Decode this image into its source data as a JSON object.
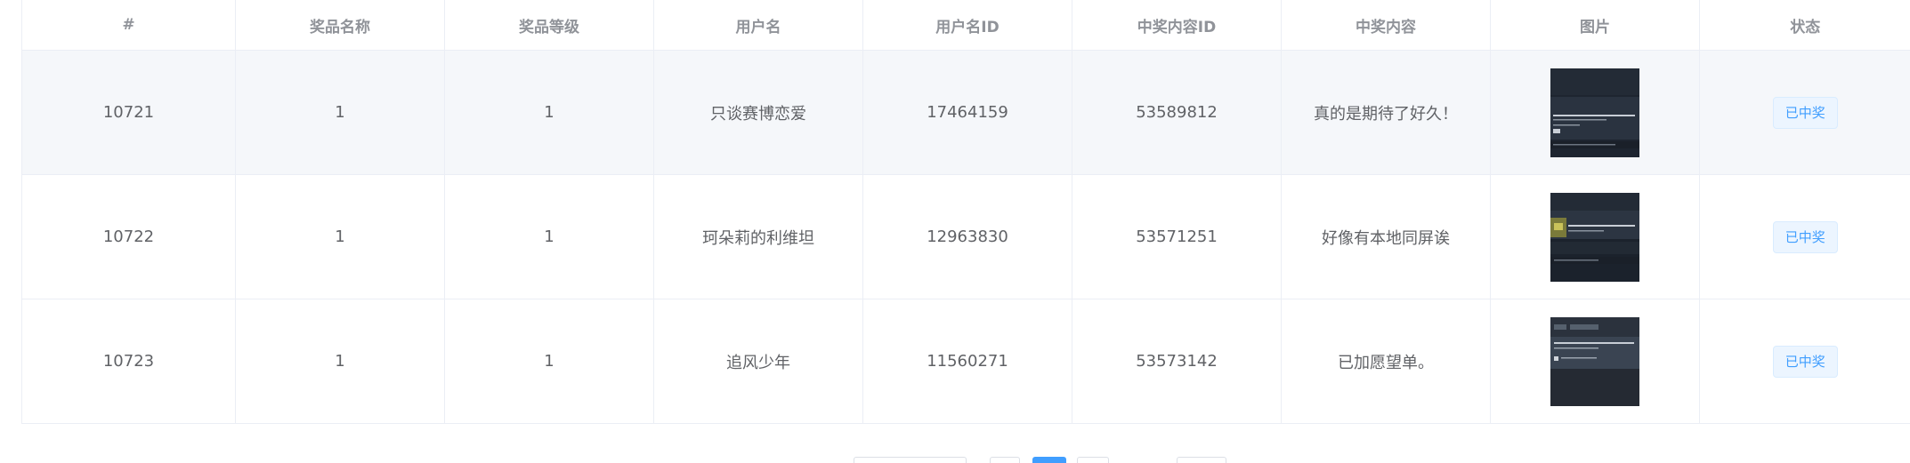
{
  "table": {
    "headers": [
      "#",
      "奖品名称",
      "奖品等级",
      "用户名",
      "用户名ID",
      "中奖内容ID",
      "中奖内容",
      "图片",
      "状态"
    ],
    "rows": [
      {
        "id": "10721",
        "prize_name": "1",
        "prize_level": "1",
        "username": "只谈赛博恋爱",
        "user_id": "17464159",
        "content_id": "53589812",
        "content": "真的是期待了好久！",
        "status": "已中奖"
      },
      {
        "id": "10722",
        "prize_name": "1",
        "prize_level": "1",
        "username": "珂朵莉的利维坦",
        "user_id": "12963830",
        "content_id": "53571251",
        "content": "好像有本地同屏诶",
        "status": "已中奖"
      },
      {
        "id": "10723",
        "prize_name": "1",
        "prize_level": "1",
        "username": "追风少年",
        "user_id": "11560271",
        "content_id": "53573142",
        "content": "已加愿望单。",
        "status": "已中奖"
      }
    ]
  },
  "colors": {
    "accent": "#409eff",
    "tag_bg": "#ecf5ff",
    "stripe": "#f5f7fa",
    "border": "#ebeef5"
  }
}
